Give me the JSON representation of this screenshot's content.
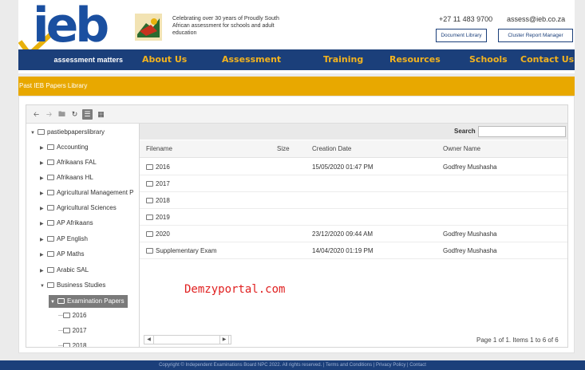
{
  "header": {
    "logo_text": "ieb",
    "logo_tagline": "assessment matters",
    "tagline": "Celebrating over 30 years of Proudly South African assessment for schools and adult education",
    "phone": "+27 11 483 9700",
    "email": "assess@ieb.co.za",
    "document_library": "Document Library",
    "cluster_report_manager": "Cluster Report Manager"
  },
  "nav": {
    "items": [
      "About Us",
      "Assessment",
      "Training",
      "Resources",
      "Schools",
      "Contact Us"
    ]
  },
  "section_title": "Past IEB Papers Library",
  "tree": {
    "root": "pastiebpaperslibrary",
    "items": [
      "Accounting",
      "Afrikaans FAL",
      "Afrikaans HL",
      "Agricultural Management P",
      "Agricultural Sciences",
      "AP Afrikaans",
      "AP English",
      "AP Maths",
      "Arabic SAL",
      "Business Studies"
    ],
    "selected": "Examination Papers",
    "children": [
      "2016",
      "2017",
      "2018"
    ]
  },
  "grid": {
    "search_label": "Search",
    "search_value": "",
    "columns": [
      "Filename",
      "Size",
      "Creation Date",
      "Owner Name"
    ],
    "rows": [
      {
        "name": "2016",
        "date": "15/05/2020 01:47 PM",
        "owner": "Godfrey Mushasha"
      },
      {
        "name": "2017",
        "date": "",
        "owner": ""
      },
      {
        "name": "2018",
        "date": "",
        "owner": ""
      },
      {
        "name": "2019",
        "date": "",
        "owner": ""
      },
      {
        "name": "2020",
        "date": "23/12/2020 09:44 AM",
        "owner": "Godfrey Mushasha"
      },
      {
        "name": "Supplementary Exam",
        "date": "14/04/2020 01:19 PM",
        "owner": "Godfrey Mushasha"
      }
    ],
    "page_info": "Page 1 of 1. Items 1 to 6 of 6"
  },
  "watermark": "Demzyportal.com",
  "footer": "Copyright © Independent Examinations Board NPC 2022. All rights reserved. | Terms and Conditions | Privacy Policy | Contact",
  "colors": {
    "navy": "#1b3f7a",
    "gold": "#e8a800",
    "nav_text": "#f3b31e",
    "watermark": "#e02020"
  }
}
